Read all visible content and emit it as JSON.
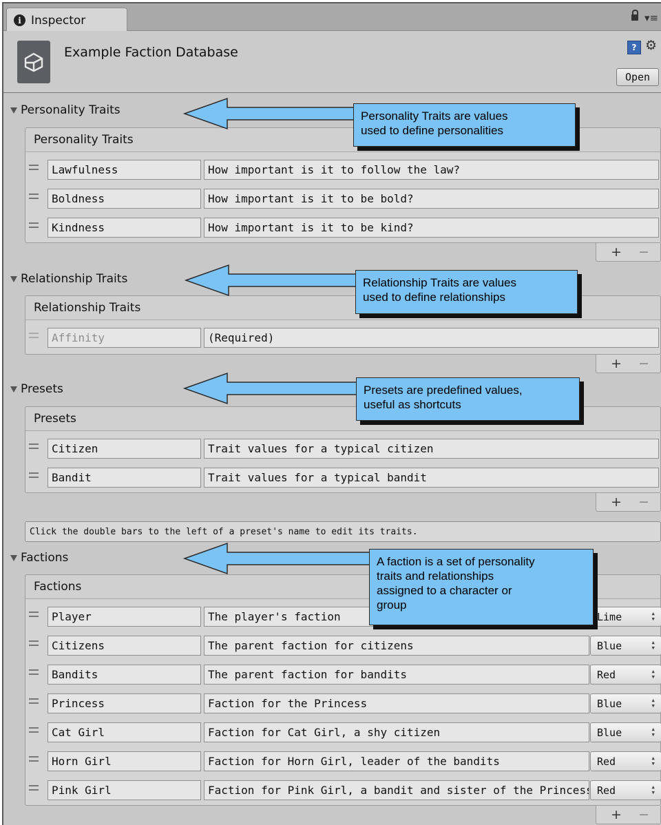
{
  "window": {
    "tab_title": "Inspector",
    "asset_title": "Example Faction Database",
    "open_button": "Open"
  },
  "sections": [
    {
      "foldout": "Personality Traits",
      "list_header": "Personality Traits",
      "rows": [
        {
          "name": "Lawfulness",
          "description": "How important is it to follow the law?"
        },
        {
          "name": "Boldness",
          "description": "How important is it to be bold?"
        },
        {
          "name": "Kindness",
          "description": "How important is it to be kind?"
        }
      ],
      "callout": [
        "Personality Traits are values",
        "used to define personalities"
      ]
    },
    {
      "foldout": "Relationship Traits",
      "list_header": "Relationship Traits",
      "rows": [
        {
          "name": "Affinity",
          "description": "(Required)",
          "disabled": true
        }
      ],
      "callout": [
        "Relationship Traits are values",
        "used to define relationships"
      ]
    },
    {
      "foldout": "Presets",
      "list_header": "Presets",
      "rows": [
        {
          "name": "Citizen",
          "description": "Trait values for a typical citizen"
        },
        {
          "name": "Bandit",
          "description": "Trait values for a typical bandit"
        }
      ],
      "callout": [
        "Presets are predefined values,",
        "useful as shortcuts"
      ],
      "help_text": "Click the double bars to the left of a preset's name to edit its traits."
    },
    {
      "foldout": "Factions",
      "list_header": "Factions",
      "rows": [
        {
          "name": "Player",
          "description": "The player's faction",
          "color": "Lime"
        },
        {
          "name": "Citizens",
          "description": "The parent faction for citizens",
          "color": "Blue"
        },
        {
          "name": "Bandits",
          "description": "The parent faction for bandits",
          "color": "Red"
        },
        {
          "name": "Princess",
          "description": "Faction for the Princess",
          "color": "Blue"
        },
        {
          "name": "Cat Girl",
          "description": "Faction for Cat Girl, a shy citizen",
          "color": "Blue"
        },
        {
          "name": "Horn Girl",
          "description": "Faction for Horn Girl, leader of the bandits",
          "color": "Red"
        },
        {
          "name": "Pink Girl",
          "description": "Faction for Pink Girl, a bandit and sister of the Princess",
          "color": "Red"
        }
      ],
      "callout": [
        "A faction is a set of personality",
        "traits and relationships",
        "assigned to a character or",
        "group"
      ]
    }
  ],
  "list_controls": {
    "add": "+",
    "remove": "−"
  },
  "icons": {
    "tab": "info-icon",
    "lock": "lock-icon",
    "menu": "menu-icon",
    "asset": "unity-logo-icon",
    "help": "help-book-icon",
    "settings": "gear-icon",
    "foldout": "triangle-down-icon",
    "drag": "drag-handle-icon",
    "dropdown": "updown-arrows-icon"
  },
  "colors": {
    "callout_fill": "#7cc3f5",
    "panel_bg": "#c8c8c8",
    "field_bg": "#e6e6e6"
  }
}
